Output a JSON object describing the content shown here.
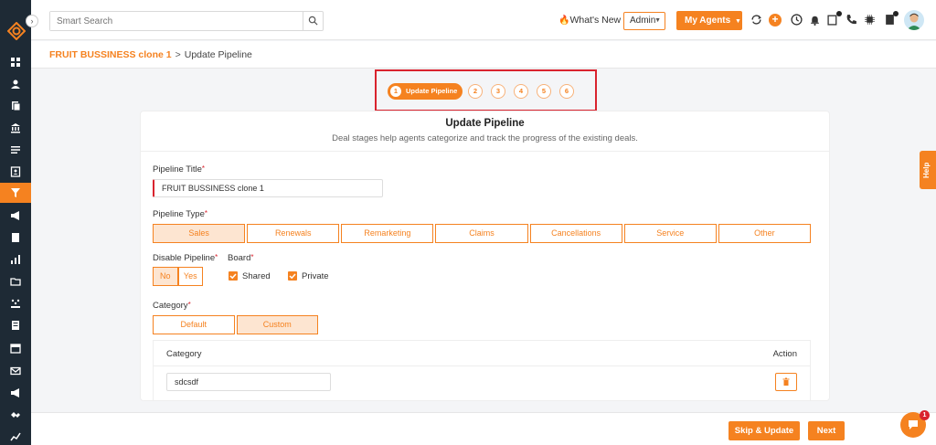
{
  "search": {
    "placeholder": "Smart Search"
  },
  "header": {
    "whats_new": "What's New",
    "admin_label": "Admin",
    "agents_label": "My Agents"
  },
  "breadcrumb": {
    "parent": "FRUIT BUSSINESS clone 1",
    "separator": ">",
    "current": "Update Pipeline"
  },
  "stepper": {
    "active_step": {
      "number": "1",
      "label": "Update Pipeline"
    },
    "steps": [
      "2",
      "3",
      "4",
      "5",
      "6"
    ]
  },
  "form": {
    "title": "Update Pipeline",
    "subtitle": "Deal stages help agents categorize and track the progress of the existing deals.",
    "pipeline_title_label": "Pipeline Title",
    "pipeline_title_value": "FRUIT BUSSINESS clone 1",
    "pipeline_type_label": "Pipeline Type",
    "pipeline_types": [
      "Sales",
      "Renewals",
      "Remarketing",
      "Claims",
      "Cancellations",
      "Service",
      "Other"
    ],
    "selected_pipeline_type": "Sales",
    "disable_pipeline_label": "Disable Pipeline",
    "disable_options": [
      "No",
      "Yes"
    ],
    "board_label": "Board",
    "board_options": [
      "Shared",
      "Private"
    ],
    "category_label": "Category",
    "category_options": [
      "Default",
      "Custom"
    ],
    "category_table": {
      "col_category": "Category",
      "col_action": "Action",
      "rows": [
        "sdcsdf"
      ]
    }
  },
  "help_label": "Help",
  "footer": {
    "skip_update": "Skip & Update",
    "next": "Next"
  },
  "chat": {
    "badge": "1"
  },
  "colors": {
    "accent": "#f58220",
    "sidebar": "#1e2a35",
    "highlight_border": "#d9232e"
  }
}
